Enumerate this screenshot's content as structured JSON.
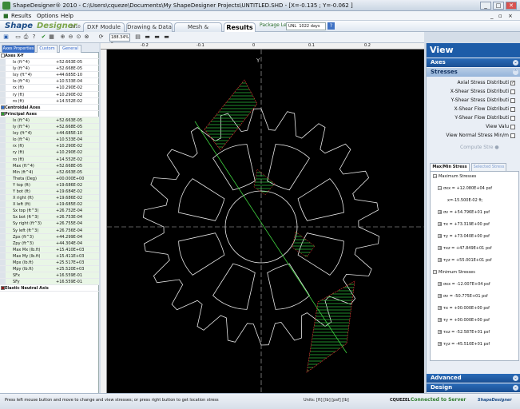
{
  "window": {
    "title": "ShapeDesigner® 2010 - C:\\Users\\cqueze\\Documents\\My ShapeDesigner Projects\\UNTITLED.SHD - [X=-0.135 ; Y=-0.062 ]",
    "min": "_",
    "max": "□",
    "close": "✕"
  },
  "menu": {
    "results": "Results",
    "options": "Options",
    "help": "Help"
  },
  "brand": {
    "shape": "Shape",
    "designer": "Designer",
    "year": "2010"
  },
  "tabs": {
    "dxf": "DXF Module",
    "drawing": "Drawing & Data",
    "mesh": "Mesh & Computing",
    "results": "Results"
  },
  "license": {
    "label": "Package Left",
    "unl": "UNL",
    "days": "1022 days",
    "help": "?"
  },
  "toolbar": {
    "zoom": "188.34% ▾"
  },
  "left_panel": {
    "tabs": {
      "axes": "Axes Properties",
      "custom": "Custom",
      "general": "General"
    },
    "rows": [
      {
        "n": "Axes X-Y",
        "v": "",
        "hdr": true,
        "color": "#ffffff"
      },
      {
        "n": "Ix    (ft^4)",
        "v": "+52.663E-05"
      },
      {
        "n": "Iy    (ft^4)",
        "v": "+52.668E-05"
      },
      {
        "n": "Ixy   (ft^4)",
        "v": "+44.685E-10"
      },
      {
        "n": "Io    (ft^4)",
        "v": "+10.533E-04"
      },
      {
        "n": "rx    (ft)",
        "v": "+10.290E-02"
      },
      {
        "n": "ry    (ft)",
        "v": "+10.290E-02"
      },
      {
        "n": "ro    (ft)",
        "v": "+14.552E-02"
      },
      {
        "n": "Centroidal Axes",
        "v": "",
        "hdr": true,
        "color": "#2f6fd1"
      },
      {
        "n": "Principal Axes",
        "v": "",
        "hdr": true,
        "color": "#2e9d2e"
      },
      {
        "n": "Ix    (ft^4)",
        "v": "+52.663E-05"
      },
      {
        "n": "Iy    (ft^4)",
        "v": "+52.668E-05"
      },
      {
        "n": "Ixy   (ft^4)",
        "v": "+44.685E-10"
      },
      {
        "n": "Io    (ft^4)",
        "v": "+10.533E-04"
      },
      {
        "n": "rx    (ft)",
        "v": "+10.290E-02"
      },
      {
        "n": "ry    (ft)",
        "v": "+10.290E-02"
      },
      {
        "n": "ro    (ft)",
        "v": "+14.552E-02"
      },
      {
        "n": "Max (ft^4)",
        "v": "+52.668E-05"
      },
      {
        "n": "Min  (ft^4)",
        "v": "+52.663E-05"
      },
      {
        "n": "Theta (Deg)",
        "v": "+00.000E+00"
      },
      {
        "n": "Y top (ft)",
        "v": "+19.686E-02"
      },
      {
        "n": "Y bot (ft)",
        "v": "+19.684E-02"
      },
      {
        "n": "X right (ft)",
        "v": "+19.686E-02"
      },
      {
        "n": "X left (ft)",
        "v": "+19.685E-02"
      },
      {
        "n": "Sx top (ft^3)",
        "v": "+26.752E-04"
      },
      {
        "n": "Sx bot (ft^3)",
        "v": "+26.753E-04"
      },
      {
        "n": "Sy right (ft^3)",
        "v": "+26.755E-04"
      },
      {
        "n": "Sy left (ft^3)",
        "v": "+26.756E-04"
      },
      {
        "n": "Zpx    (ft^3)",
        "v": "+44.299E-04"
      },
      {
        "n": "Zpy    (ft^3)",
        "v": "+44.304E-04"
      },
      {
        "n": "Max Mx (lb.ft)",
        "v": "+15.410E+03"
      },
      {
        "n": "Max My (lb.ft)",
        "v": "+15.411E+03"
      },
      {
        "n": "Mpx    (lb.ft)",
        "v": "+25.517E+03"
      },
      {
        "n": "Mpy    (lb.ft)",
        "v": "+25.520E+03"
      },
      {
        "n": "SFx",
        "v": "+16.559E-01"
      },
      {
        "n": "SFy",
        "v": "+16.559E-01"
      },
      {
        "n": "Elastic Neutral Axis",
        "v": "",
        "hdr": true,
        "color": "#8b1c1c"
      }
    ]
  },
  "canvas": {
    "top_ticks": [
      "-0.2",
      "-0.1",
      "0",
      "0.1",
      "0.2"
    ],
    "axis_y": "Y"
  },
  "right_panel": {
    "title": "View",
    "axes": "Axes",
    "stresses": "Stresses",
    "options": [
      {
        "label": "Axial Stress Distributi",
        "checked": true
      },
      {
        "label": "X-Shear Stress Distributi",
        "checked": false
      },
      {
        "label": "Y-Shear Stress Distributi",
        "checked": false
      },
      {
        "label": "X-Shear Flow Distributi",
        "checked": false
      },
      {
        "label": "Y-Shear Flow Distributi",
        "checked": false
      },
      {
        "label": "View Valu",
        "checked": false
      },
      {
        "label": "View Normal Stress Min/m",
        "checked": false
      }
    ],
    "compute": "Compute Stre",
    "stress_tabs": {
      "maxmin": "Max/Min Stress",
      "selected": "Selected Stress"
    },
    "tree": [
      {
        "t": "Maximum Stresses",
        "lvl": 0,
        "box": "−"
      },
      {
        "t": "σxx = +12.080E+04 psf",
        "lvl": 1,
        "box": "−"
      },
      {
        "t": "x=-15.500E-02 ft;",
        "lvl": 3,
        "box": ""
      },
      {
        "t": "σv = +54.796E+01 psf",
        "lvl": 1,
        "box": "+"
      },
      {
        "t": "τx = +73.319E+00 psf",
        "lvl": 1,
        "box": "+"
      },
      {
        "t": "τy = +73.040E+00 psf",
        "lvl": 1,
        "box": "+"
      },
      {
        "t": "τxz = +47.849E+01 psf",
        "lvl": 1,
        "box": "+"
      },
      {
        "t": "τyz = +55.001E+01 psf",
        "lvl": 1,
        "box": "+"
      },
      {
        "t": "Minimum Stresses",
        "lvl": 0,
        "box": "−"
      },
      {
        "t": "σxx = -12.007E+04 psf",
        "lvl": 1,
        "box": "+"
      },
      {
        "t": "σv = -50.775E+01 psf",
        "lvl": 1,
        "box": "+"
      },
      {
        "t": "τx = +00.000E+00 psf",
        "lvl": 1,
        "box": "+"
      },
      {
        "t": "τy = +00.000E+00 psf",
        "lvl": 1,
        "box": "+"
      },
      {
        "t": "τxz = -52.587E+01 psf",
        "lvl": 1,
        "box": "+"
      },
      {
        "t": "τyz = -45.510E+01 psf",
        "lvl": 1,
        "box": "+"
      }
    ],
    "advanced": "Advanced",
    "design": "Design"
  },
  "status": {
    "hint": "Press left mouse button and move to change and view stresses; or press right button to get location stress",
    "units": "Units: [ft] [lb] [psf] [lb]",
    "company": "CQUEZEL",
    "connected": "Connected to Server",
    "logo": "ShapeDesigner"
  }
}
